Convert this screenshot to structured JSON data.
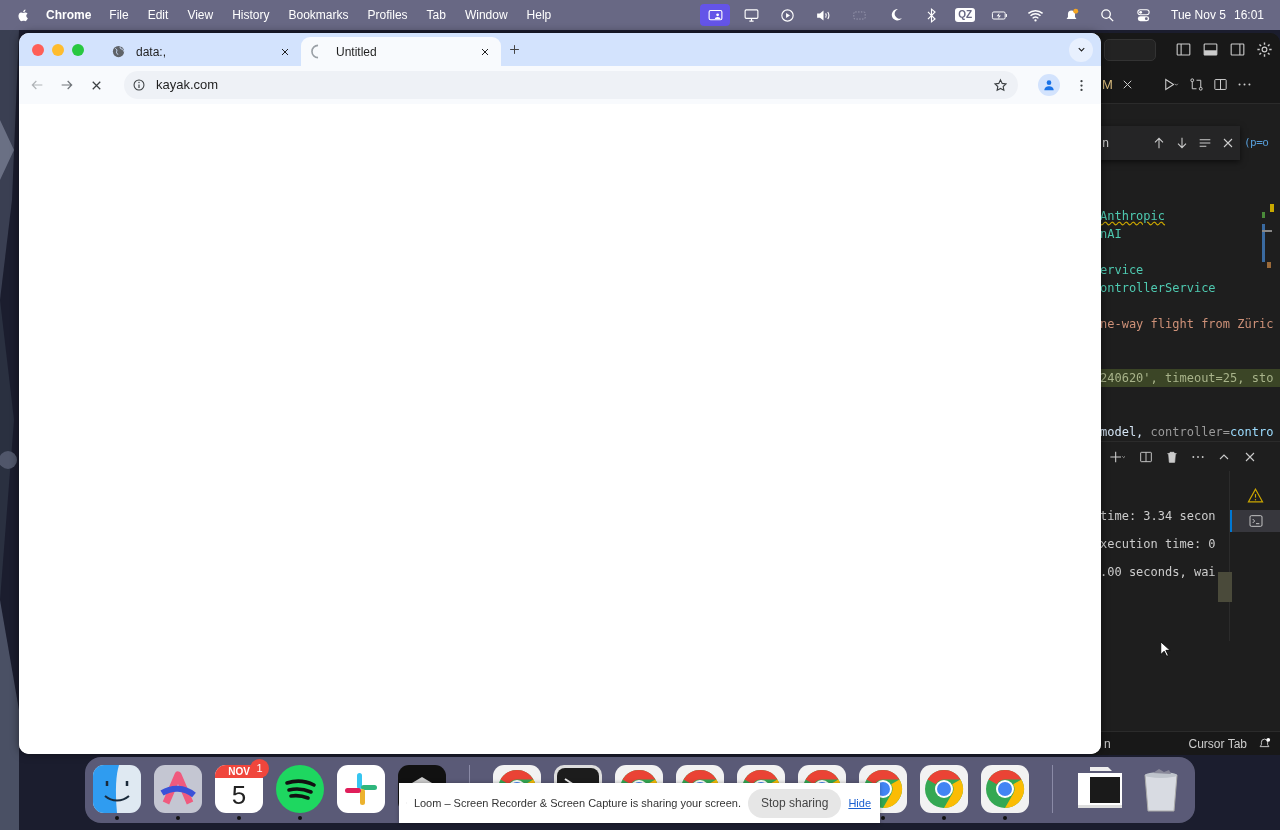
{
  "menu_bar": {
    "app": "Chrome",
    "menus": [
      "File",
      "Edit",
      "View",
      "History",
      "Bookmarks",
      "Profiles",
      "Tab",
      "Window",
      "Help"
    ],
    "status_icons": [
      {
        "kind": "screen-share",
        "selected": true
      },
      {
        "kind": "display",
        "selected": false
      },
      {
        "kind": "play",
        "selected": false
      },
      {
        "kind": "volume",
        "selected": false
      },
      {
        "kind": "dim-box",
        "selected": false
      },
      {
        "kind": "moon",
        "selected": false
      },
      {
        "kind": "bluetooth",
        "selected": false
      },
      {
        "kind": "input",
        "text": "QZ",
        "selected": false
      },
      {
        "kind": "battery",
        "selected": false
      },
      {
        "kind": "wifi",
        "selected": false
      },
      {
        "kind": "notify",
        "selected": false
      },
      {
        "kind": "search",
        "selected": false
      },
      {
        "kind": "control",
        "selected": false
      }
    ],
    "date": "Tue Nov 5",
    "time": "16:01"
  },
  "browser": {
    "tabs": [
      {
        "title": "data:,",
        "loading": false,
        "selected": false
      },
      {
        "title": "Untitled",
        "loading": true,
        "selected": true
      }
    ],
    "loading": true,
    "address": "kayak.com"
  },
  "editor": {
    "tab_label": "M",
    "find_text": "n",
    "find_tail": "(p=o",
    "lines": [
      {
        "kind": "code",
        "segments": [
          {
            "kind": "type-warn",
            "text": "Anthropic"
          }
        ]
      },
      {
        "kind": "code",
        "segments": [
          {
            "kind": "type",
            "text": "nAI"
          }
        ]
      },
      {
        "kind": "blank"
      },
      {
        "kind": "code",
        "segments": [
          {
            "kind": "type",
            "text": "ervice"
          }
        ]
      },
      {
        "kind": "code",
        "segments": [
          {
            "kind": "type",
            "text": "ontrollerService"
          }
        ]
      },
      {
        "kind": "blank"
      },
      {
        "kind": "code",
        "segments": [
          {
            "kind": "string",
            "text": "ne-way flight from Züric"
          }
        ]
      },
      {
        "kind": "blank"
      },
      {
        "kind": "blank"
      },
      {
        "kind": "highlight",
        "segments": [
          {
            "kind": "plain",
            "text": "240620', timeout=25, sto"
          }
        ]
      },
      {
        "kind": "blank"
      },
      {
        "kind": "blank"
      },
      {
        "kind": "code",
        "segments": [
          {
            "kind": "variable",
            "text": "model, "
          },
          {
            "kind": "param",
            "text": "controller="
          },
          {
            "kind": "name",
            "text": "contro"
          }
        ]
      }
    ],
    "terminal": [
      "time: 3.34 secon",
      "xecution time: 0",
      ".00 seconds, wai"
    ],
    "status_left": "n",
    "status_right": "Cursor Tab"
  },
  "dock": {
    "apps": [
      {
        "kind": "finder",
        "running": true
      },
      {
        "kind": "arc",
        "running": true
      },
      {
        "kind": "calendar",
        "month": "NOV",
        "day": "5",
        "badge": "1",
        "running": true
      },
      {
        "kind": "spotify",
        "running": true
      },
      {
        "kind": "slack",
        "running": false
      },
      {
        "kind": "dark-app"
      },
      {
        "kind": "divider"
      },
      {
        "kind": "chrome"
      },
      {
        "kind": "terminal"
      },
      {
        "kind": "chrome"
      },
      {
        "kind": "chrome"
      },
      {
        "kind": "chrome"
      },
      {
        "kind": "chrome"
      },
      {
        "kind": "chrome",
        "running": true
      },
      {
        "kind": "chrome",
        "running": true
      },
      {
        "kind": "chrome",
        "running": true
      },
      {
        "kind": "divider"
      },
      {
        "kind": "window-preview",
        "running": false
      },
      {
        "kind": "trash",
        "running": false
      }
    ]
  },
  "share_bar": {
    "message": "Loom – Screen Recorder & Screen Capture is sharing your screen.",
    "stop": "Stop sharing",
    "hide": "Hide"
  }
}
